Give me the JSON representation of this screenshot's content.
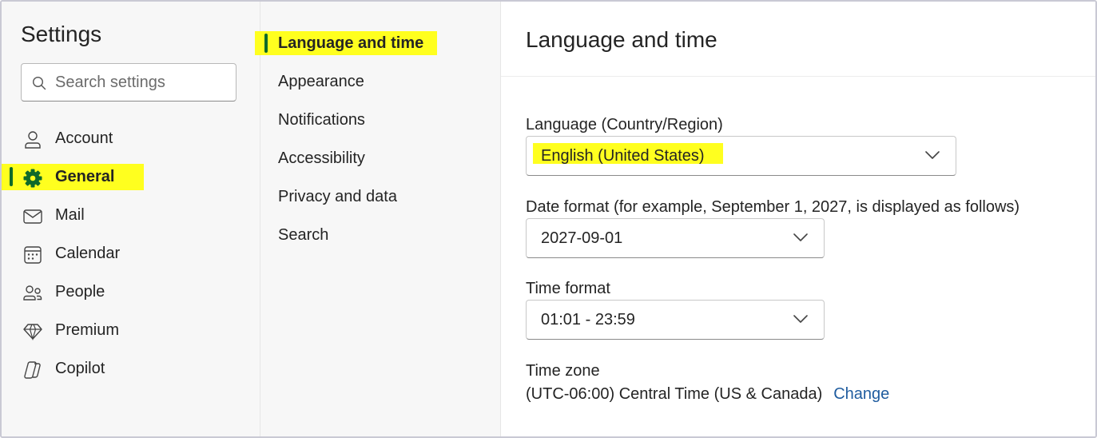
{
  "left_nav": {
    "title": "Settings",
    "search": {
      "placeholder": "Search settings",
      "value": ""
    },
    "items": [
      {
        "label": "Account",
        "icon": "person-icon"
      },
      {
        "label": "General",
        "icon": "gear-icon"
      },
      {
        "label": "Mail",
        "icon": "mail-icon"
      },
      {
        "label": "Calendar",
        "icon": "calendar-icon"
      },
      {
        "label": "People",
        "icon": "people-icon"
      },
      {
        "label": "Premium",
        "icon": "diamond-icon"
      },
      {
        "label": "Copilot",
        "icon": "copilot-icon"
      }
    ],
    "active": "General"
  },
  "sub_nav": {
    "items": [
      {
        "label": "Language and time"
      },
      {
        "label": "Appearance"
      },
      {
        "label": "Notifications"
      },
      {
        "label": "Accessibility"
      },
      {
        "label": "Privacy and data"
      },
      {
        "label": "Search"
      }
    ],
    "active": "Language and time"
  },
  "panel": {
    "title": "Language and time",
    "language": {
      "label": "Language (Country/Region)",
      "value": "English (United States)"
    },
    "date_format": {
      "label": "Date format (for example, September 1, 2027, is displayed as follows)",
      "value": "2027-09-01"
    },
    "time_format": {
      "label": "Time format",
      "value": "01:01 - 23:59"
    },
    "time_zone": {
      "label": "Time zone",
      "value": "(UTC-06:00) Central Time (US & Canada)",
      "change_label": "Change"
    }
  },
  "colors": {
    "highlight": "#ffff1f",
    "active_bar": "#0f6a2a",
    "active_icon": "#0f6a2a",
    "link": "#1f5c9f",
    "nav_bg": "#f7f7f7"
  }
}
